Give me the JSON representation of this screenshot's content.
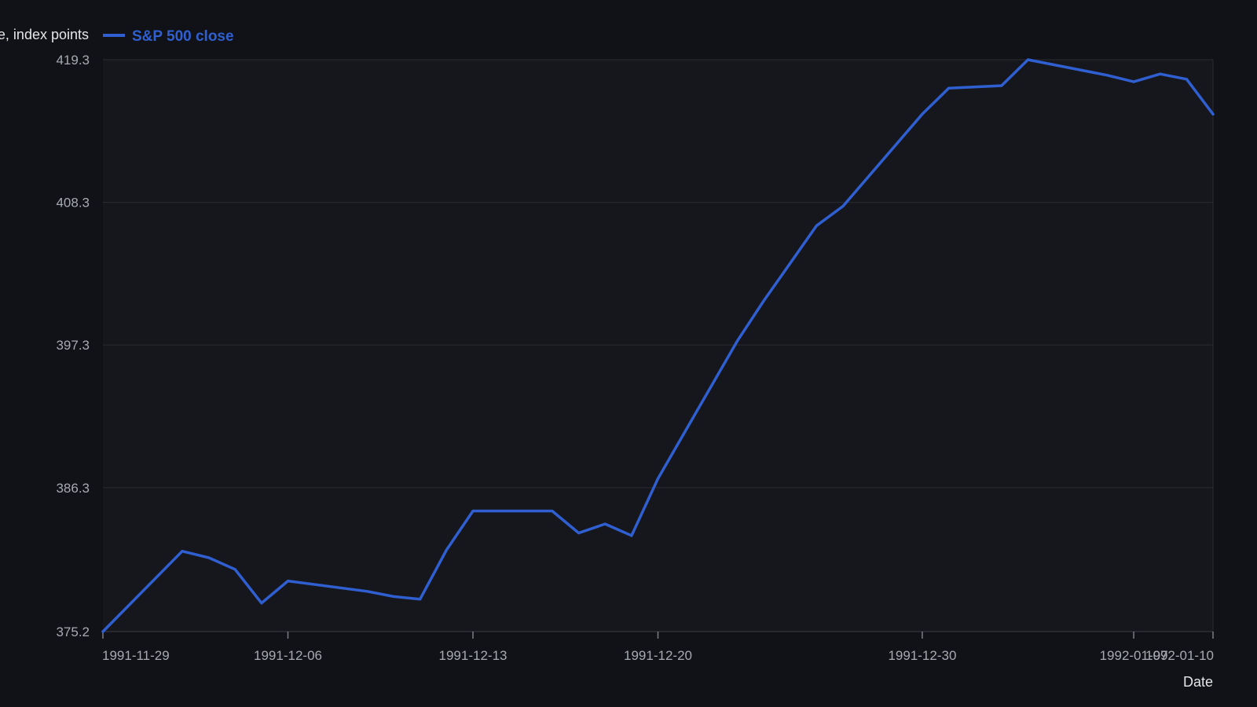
{
  "colors": {
    "background": "#111217",
    "plot_background": "#16171c",
    "grid": "#2a2c33",
    "tick_text": "#a7aab2",
    "axis_title": "#e6e6e8",
    "series": "#2f5fd0"
  },
  "chart_data": {
    "type": "line",
    "xlabel": "Date",
    "ylabel": "Close, index points",
    "ylim": [
      375.2,
      419.3
    ],
    "yticks": [
      "375.2",
      "386.3",
      "397.3",
      "408.3",
      "419.3"
    ],
    "xticks": [
      {
        "date": "1991-11-29",
        "label": "1991-11-29"
      },
      {
        "date": "1991-12-06",
        "label": "1991-12-06"
      },
      {
        "date": "1991-12-13",
        "label": "1991-12-13"
      },
      {
        "date": "1991-12-20",
        "label": "1991-12-20"
      },
      {
        "date": "1991-12-30",
        "label": "1991-12-30"
      },
      {
        "date": "1992-01-07",
        "label": "1992-01-07"
      },
      {
        "date": "1992-01-10",
        "label": "1992-01-10"
      }
    ],
    "xrange": [
      "1991-11-29",
      "1992-01-10"
    ],
    "grid": true,
    "legend_position": "top-left",
    "series": [
      {
        "name": "S&P 500 close",
        "x": [
          "1991-11-29",
          "1991-12-02",
          "1991-12-03",
          "1991-12-04",
          "1991-12-05",
          "1991-12-06",
          "1991-12-09",
          "1991-12-10",
          "1991-12-11",
          "1991-12-12",
          "1991-12-13",
          "1991-12-16",
          "1991-12-17",
          "1991-12-18",
          "1991-12-19",
          "1991-12-20",
          "1991-12-23",
          "1991-12-24",
          "1991-12-26",
          "1991-12-27",
          "1991-12-30",
          "1991-12-31",
          "1992-01-02",
          "1992-01-03",
          "1992-01-06",
          "1992-01-07",
          "1992-01-08",
          "1992-01-09",
          "1992-01-10"
        ],
        "values": [
          375.2,
          381.4,
          380.9,
          380.0,
          377.4,
          379.1,
          378.3,
          377.9,
          377.7,
          381.5,
          384.5,
          384.5,
          382.8,
          383.5,
          382.6,
          387.0,
          397.6,
          400.7,
          406.5,
          408.0,
          415.1,
          417.1,
          417.3,
          419.3,
          418.1,
          417.6,
          418.2,
          417.8,
          415.1
        ]
      }
    ]
  }
}
